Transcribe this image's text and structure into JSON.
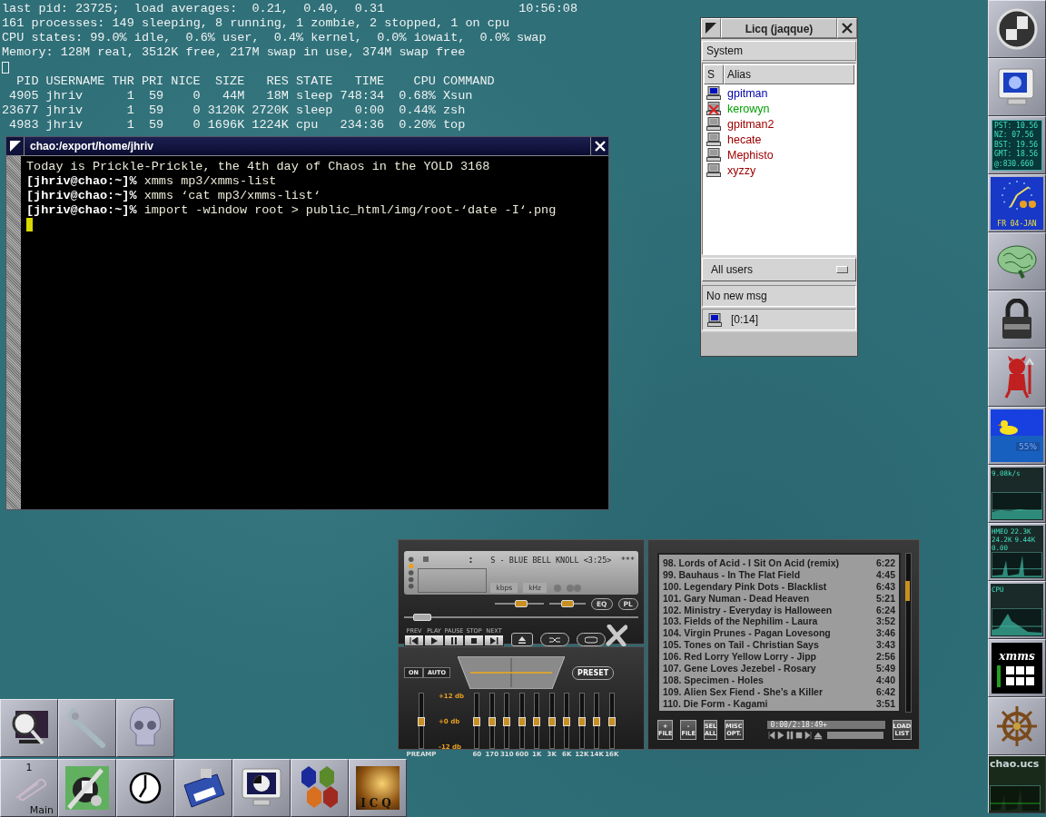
{
  "top": {
    "summary": [
      "last pid: 23725;  load averages:  0.21,  0.40,  0.31",
      "161 processes: 149 sleeping, 8 running, 1 zombie, 2 stopped, 1 on cpu",
      "CPU states: 99.0% idle,  0.6% user,  0.4% kernel,  0.0% iowait,  0.0% swap",
      "Memory: 128M real, 3512K free, 217M swap in use, 374M swap free"
    ],
    "clock": "10:56:08",
    "table": {
      "columns": [
        "PID",
        "USERNAME",
        "THR",
        "PRI",
        "NICE",
        "SIZE",
        "RES",
        "STATE",
        "TIME",
        "CPU",
        "COMMAND"
      ],
      "rows": [
        [
          "4905",
          "jhriv",
          "1",
          "59",
          "0",
          "44M",
          "18M",
          "sleep",
          "748:34",
          "0.68%",
          "Xsun"
        ],
        [
          "23677",
          "jhriv",
          "1",
          "59",
          "0",
          "3120K",
          "2720K",
          "sleep",
          "0:00",
          "0.44%",
          "zsh"
        ],
        [
          "4983",
          "jhriv",
          "1",
          "59",
          "0",
          "1696K",
          "1224K",
          "cpu",
          "234:36",
          "0.20%",
          "top"
        ]
      ]
    }
  },
  "terminal": {
    "title": "chao:/export/home/jhriv",
    "lines": [
      {
        "kind": "output",
        "text": "Today is Prickle-Prickle, the 4th day of Chaos in the YOLD 3168"
      },
      {
        "kind": "command",
        "prompt": "[jhriv@chao:~]%",
        "text": "xmms mp3/xmms-list"
      },
      {
        "kind": "command",
        "prompt": "[jhriv@chao:~]%",
        "text": "xmms ‘cat mp3/xmms-list‘"
      },
      {
        "kind": "command",
        "prompt": "[jhriv@chao:~]%",
        "text": "import -window root > public_html/img/root-‘date -I‘.png"
      }
    ]
  },
  "licq": {
    "title": "Licq (jaqque)",
    "menu": [
      "System"
    ],
    "columns": [
      "S",
      "Alias"
    ],
    "contacts": [
      {
        "alias": "gpitman",
        "kind": "online",
        "color": "#0000a8"
      },
      {
        "alias": "kerowyn",
        "kind": "occupied",
        "color": "#00a000"
      },
      {
        "alias": "gpitman2",
        "kind": "offline",
        "color": "#a00000"
      },
      {
        "alias": "hecate",
        "kind": "offline",
        "color": "#a00000"
      },
      {
        "alias": "Mephisto",
        "kind": "offline",
        "color": "#a00000"
      },
      {
        "alias": "xyzzy",
        "kind": "offline",
        "color": "#a00000"
      }
    ],
    "group": "All users",
    "messages": "No new msg",
    "status": "[0:14]"
  },
  "xmms": {
    "player": {
      "time": ":",
      "marquee": "S - BLUE BELL KNOLL <3:25>  ***",
      "bitrate_label": "kbps",
      "rate_label": "kHz",
      "volume": {
        "level": 0.55
      },
      "balance": {
        "level": 0.5
      },
      "seek": {
        "level": 0.04
      },
      "eq_button": "EQ",
      "pl_button": "PL",
      "transport": [
        "PREV",
        "PLAY",
        "PAUSE",
        "STOP",
        "NEXT"
      ]
    },
    "equalizer": {
      "on": "ON",
      "auto": "AUTO",
      "preset": "PRESET",
      "scale": [
        "+12 db",
        "+0 db",
        "-12 db"
      ],
      "preamp": {
        "label": "PREAMP",
        "level": 0.5
      },
      "bands": [
        {
          "label": "60",
          "level": 0.5
        },
        {
          "label": "170",
          "level": 0.5
        },
        {
          "label": "310",
          "level": 0.5
        },
        {
          "label": "600",
          "level": 0.5
        },
        {
          "label": "1K",
          "level": 0.5
        },
        {
          "label": "3K",
          "level": 0.5
        },
        {
          "label": "6K",
          "level": 0.5
        },
        {
          "label": "12K",
          "level": 0.5
        },
        {
          "label": "14K",
          "level": 0.5
        },
        {
          "label": "16K",
          "level": 0.5
        }
      ]
    },
    "playlist": {
      "tracks": [
        {
          "title": "98. Lords of Acid - I Sit On Acid (remix)",
          "time": "6:22"
        },
        {
          "title": "99. Bauhaus - In The Flat Field",
          "time": "4:45"
        },
        {
          "title": "100. Legendary Pink Dots - Blacklist",
          "time": "6:43"
        },
        {
          "title": "101. Gary Numan - Dead Heaven",
          "time": "5:21"
        },
        {
          "title": "102. Ministry - Everyday is Halloween",
          "time": "6:24"
        },
        {
          "title": "103. Fields of the Nephilim - Laura",
          "time": "3:52"
        },
        {
          "title": "104. Virgin Prunes - Pagan Lovesong",
          "time": "3:46"
        },
        {
          "title": "105. Tones on Tail - Christian Says",
          "time": "3:43"
        },
        {
          "title": "106. Red Lorry Yellow Lorry - Jipp",
          "time": "2:56"
        },
        {
          "title": "107. Gene Loves Jezebel - Rosary",
          "time": "5:49"
        },
        {
          "title": "108. Specimen - Holes",
          "time": "4:40"
        },
        {
          "title": "109. Alien Sex Fiend - She’s a Killer",
          "time": "6:42"
        },
        {
          "title": "110. Die Form - Kagami",
          "time": "3:51"
        }
      ],
      "buttons": [
        "+ FILE",
        "- FILE",
        "SEL ALL",
        "MISC OPT."
      ],
      "position": "0:00/2:18:49+",
      "load_button": "LOAD LIST"
    }
  },
  "dock": [
    {
      "kind": "logo"
    },
    {
      "kind": "monitor"
    },
    {
      "kind": "worldclock",
      "texts": [
        "PST: 10.56",
        "NZ: 07.56",
        "BST: 19.56",
        "GMT: 18.56",
        "@:830.660"
      ]
    },
    {
      "kind": "calendar",
      "texts": [
        "FR 04-JAN"
      ]
    },
    {
      "kind": "brain"
    },
    {
      "kind": "lock"
    },
    {
      "kind": "devil"
    },
    {
      "kind": "duck",
      "texts": [
        "55%"
      ]
    },
    {
      "kind": "netload",
      "texts": [
        "9.08k/s"
      ]
    },
    {
      "kind": "netgraph",
      "texts": [
        "HMEO",
        "22.3K",
        "24.2K",
        "9.44K",
        "0.00"
      ]
    },
    {
      "kind": "cpu",
      "texts": [
        "CPU"
      ]
    },
    {
      "kind": "xmms",
      "texts": [
        "xmms"
      ]
    },
    {
      "kind": "wheel"
    },
    {
      "kind": "host",
      "texts": [
        "chao.ucs"
      ]
    }
  ],
  "launcher": [
    [
      {
        "kind": "magnifier"
      },
      {
        "kind": "wrench"
      },
      {
        "kind": "skull"
      }
    ],
    [
      {
        "kind": "pager",
        "texts": [
          "1",
          "Main"
        ]
      },
      {
        "kind": "paint"
      },
      {
        "kind": "clock"
      },
      {
        "kind": "calculator"
      },
      {
        "kind": "monitor"
      },
      {
        "kind": "hexes"
      },
      {
        "kind": "icq",
        "texts": [
          "ICQ"
        ]
      }
    ]
  ]
}
